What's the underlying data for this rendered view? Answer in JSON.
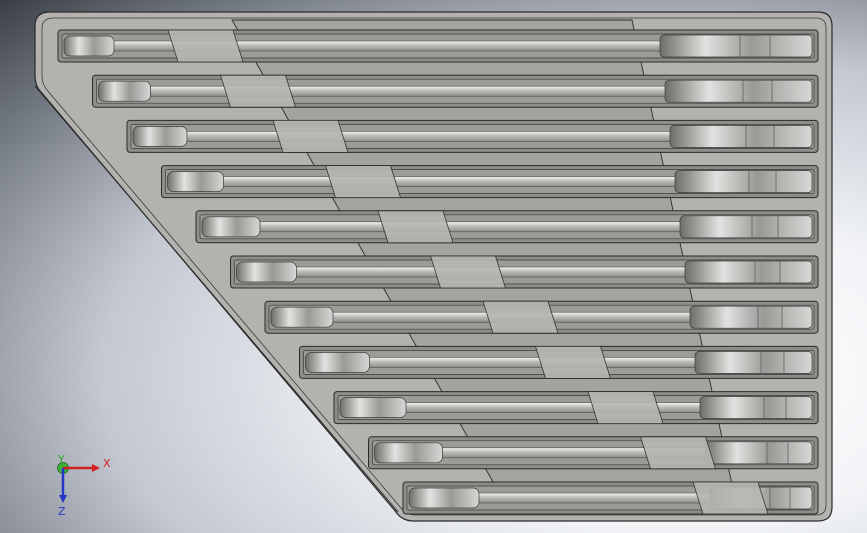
{
  "viewport": {
    "background": "#c9ced6",
    "model_outline_color": "#2b2b2b",
    "tray_face_color": "#a9a7a2",
    "slot_color": "#8a8885",
    "wrench_color": "#b8b7b4",
    "wrench_highlight": "#e8e8e8"
  },
  "tray": {
    "slot_count": 11,
    "slots": [
      {
        "id": "slot-1"
      },
      {
        "id": "slot-2"
      },
      {
        "id": "slot-3"
      },
      {
        "id": "slot-4"
      },
      {
        "id": "slot-5"
      },
      {
        "id": "slot-6"
      },
      {
        "id": "slot-7"
      },
      {
        "id": "slot-8"
      },
      {
        "id": "slot-9"
      },
      {
        "id": "slot-10"
      },
      {
        "id": "slot-11"
      }
    ]
  },
  "triad": {
    "x_label": "X",
    "y_label": "Y",
    "z_label": "Z",
    "x_color": "#d21f1f",
    "y_color": "#2aa52a",
    "z_color": "#2536c8"
  }
}
